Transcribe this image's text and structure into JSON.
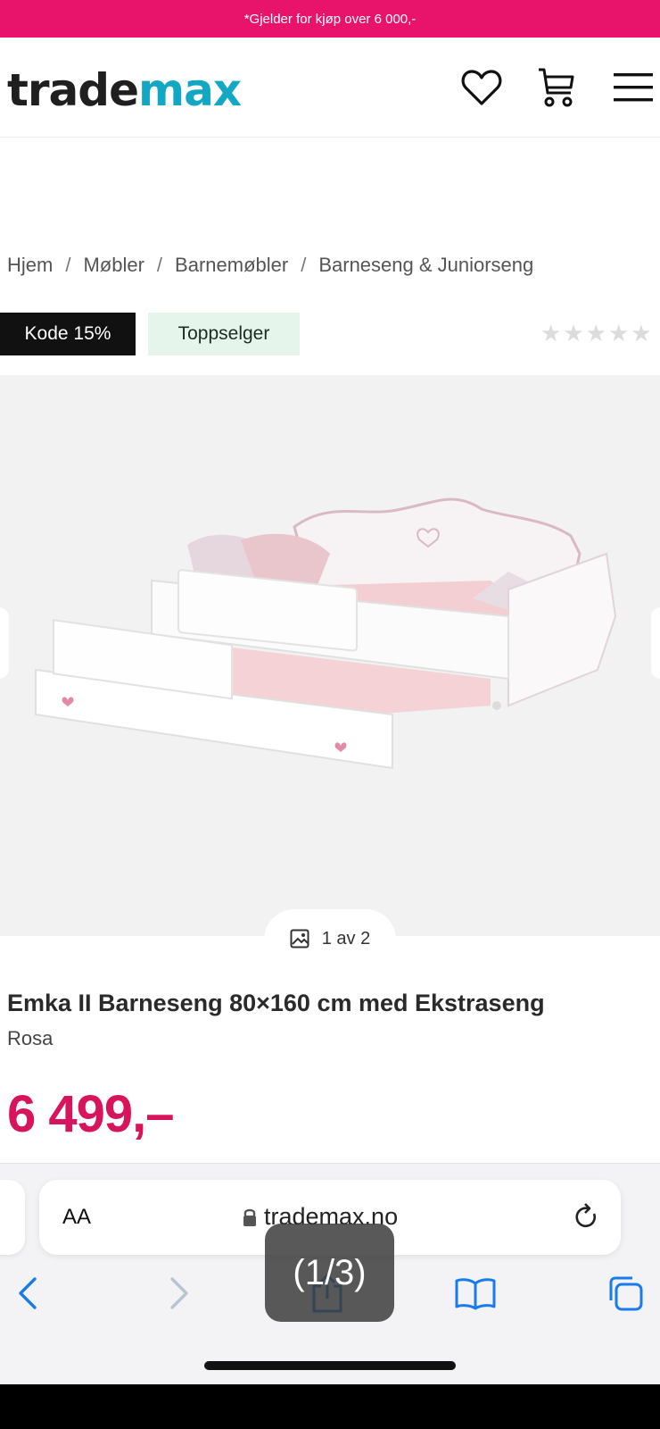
{
  "promo": {
    "text": "*Gjelder for kjøp over 6 000,-"
  },
  "header": {
    "logo_part1": "trade",
    "logo_part2": "max",
    "icons": [
      "heart-icon",
      "cart-icon",
      "menu-icon"
    ]
  },
  "breadcrumb": {
    "items": [
      "Hjem",
      "Møbler",
      "Barnemøbler",
      "Barneseng & Juniorseng"
    ],
    "separator": "/"
  },
  "badges": {
    "code": "Kode 15%",
    "tag": "Toppselger"
  },
  "rating": {
    "stars_filled": 0,
    "stars_total": 5
  },
  "gallery": {
    "counter": "1 av 2"
  },
  "product": {
    "title": "Emka II Barneseng 80×160 cm med Ekstraseng",
    "variant": "Rosa",
    "price": "6 499,–"
  },
  "browser": {
    "aa_label": "AA",
    "url": "trademax.no",
    "overlay_counter": "(1/3)"
  },
  "colors": {
    "brand_pink": "#e8146c",
    "price_pink": "#d8145c",
    "logo_blue": "#12a8c3",
    "safari_blue": "#1a7bea"
  }
}
